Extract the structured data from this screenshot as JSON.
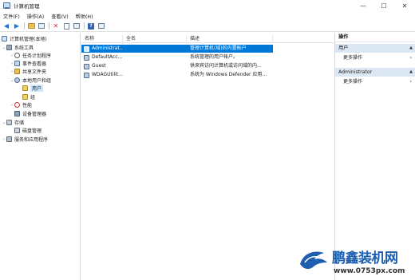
{
  "window": {
    "title": "计算机管理"
  },
  "window_controls": {
    "minimize": "—",
    "maximize": "☐",
    "close": "✕"
  },
  "menubar": {
    "items": [
      "文件(F)",
      "操作(A)",
      "查看(V)",
      "帮助(H)"
    ]
  },
  "toolbar": {
    "icons": [
      "back-icon",
      "forward-icon",
      "up-icon",
      "show-hide-tree-icon",
      "delete-icon",
      "properties-icon",
      "export-icon",
      "help-icon",
      "view-icon"
    ]
  },
  "tree": {
    "root": "计算机管理(本地)",
    "system_tools": "系统工具",
    "task_scheduler": "任务计划程序",
    "event_viewer": "事件查看器",
    "shared_folders": "共享文件夹",
    "local_users_groups": "本地用户和组",
    "users": "用户",
    "groups": "组",
    "performance": "性能",
    "device_manager": "设备管理器",
    "storage": "存储",
    "disk_management": "磁盘管理",
    "services_apps": "服务和应用程序"
  },
  "list": {
    "columns": {
      "name": "名称",
      "fullname": "全名",
      "description": "描述"
    },
    "rows": [
      {
        "name": "Administrat...",
        "fullname": "",
        "description": "管理计算机(域)的内置帐户"
      },
      {
        "name": "DefaultAcc...",
        "fullname": "",
        "description": "系统管理的用户帐户。"
      },
      {
        "name": "Guest",
        "fullname": "",
        "description": "供来宾访问计算机或访问域的内..."
      },
      {
        "name": "WDAGUtilit...",
        "fullname": "",
        "description": "系统为 Windows Defender 应用..."
      }
    ],
    "selected_index": 0
  },
  "actions": {
    "title": "操作",
    "section1": "用户",
    "section1_more": "更多操作",
    "section2": "Administrator",
    "section2_more": "更多操作"
  },
  "watermark": {
    "brand": "鹏鑫装机网",
    "url": "www.0753px.com"
  },
  "colors": {
    "selection": "#0078d7",
    "tree_selection": "#cce8ff",
    "action_header": "#dbe7f3",
    "brand": "#1d5fae"
  }
}
